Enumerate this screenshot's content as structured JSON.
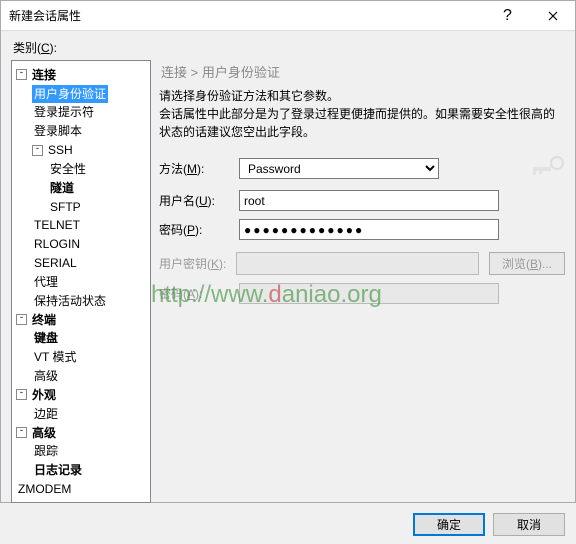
{
  "title": "新建会话属性",
  "category_label": "类别(",
  "category_key": "C",
  "category_label_after": "):",
  "breadcrumb": "连接 > 用户身份验证",
  "description_line1": "请选择身份验证方法和其它参数。",
  "description_line2": "会话属性中此部分是为了登录过程更便捷而提供的。如果需要安全性很高的状态的话建议您空出此字段。",
  "form": {
    "method_label": "方法(",
    "method_key": "M",
    "method_after": "):",
    "method_value": "Password",
    "user_label": "用户名(",
    "user_key": "U",
    "user_after": "):",
    "user_value": "root",
    "password_label": "密码(",
    "password_key": "P",
    "password_after": "):",
    "password_value": "●●●●●●●●●●●●●",
    "pubkey_label": "用户密钥(",
    "pubkey_key": "K",
    "pubkey_after": "):",
    "browse_label": "浏览(",
    "browse_key": "B",
    "browse_after": ")...",
    "passphrase_label": "密码(",
    "passphrase_key": "A",
    "passphrase_after": "):"
  },
  "buttons": {
    "ok": "确定",
    "cancel": "取消"
  },
  "tree": {
    "connection": "连接",
    "auth": "用户身份验证",
    "login_prompt": "登录提示符",
    "login_script": "登录脚本",
    "ssh": "SSH",
    "security": "安全性",
    "tunnel": "隧道",
    "sftp": "SFTP",
    "telnet": "TELNET",
    "rlogin": "RLOGIN",
    "serial": "SERIAL",
    "proxy": "代理",
    "keepalive": "保持活动状态",
    "terminal": "终端",
    "keyboard": "键盘",
    "vt": "VT 模式",
    "advanced_term": "高级",
    "appearance": "外观",
    "margin": "边距",
    "advanced": "高级",
    "trace": "跟踪",
    "logging": "日志记录",
    "zmodem": "ZMODEM"
  },
  "watermark": "http://www.daniao.org"
}
